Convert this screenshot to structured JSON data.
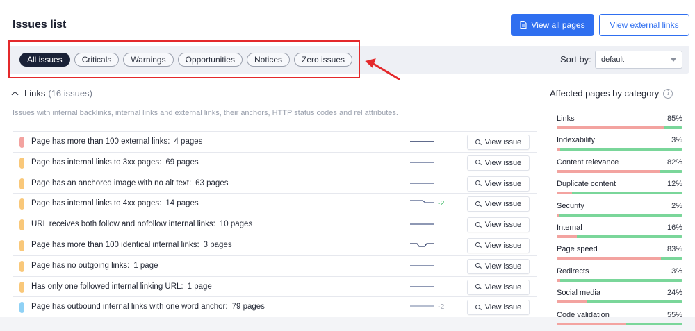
{
  "header": {
    "title": "Issues list",
    "view_all_pages": "View all pages",
    "view_external_links": "View external links"
  },
  "filters": [
    {
      "label": "All issues",
      "active": true
    },
    {
      "label": "Criticals",
      "active": false
    },
    {
      "label": "Warnings",
      "active": false
    },
    {
      "label": "Opportunities",
      "active": false
    },
    {
      "label": "Notices",
      "active": false
    },
    {
      "label": "Zero issues",
      "active": false
    }
  ],
  "sort": {
    "label": "Sort by:",
    "value": "default"
  },
  "section": {
    "name": "Links",
    "count": "(16 issues)",
    "description": "Issues with internal backlinks, internal links and external links, their anchors, HTTP status codes and rel attributes."
  },
  "issues": [
    {
      "name": "Page has more than 100 external links:",
      "count": "4 pages",
      "severity": "critical",
      "delta": "",
      "trend": "flat-dark"
    },
    {
      "name": "Page has internal links to 3xx pages:",
      "count": "69 pages",
      "severity": "warning",
      "delta": "",
      "trend": "flat"
    },
    {
      "name": "Page has an anchored image with no alt text:",
      "count": "63 pages",
      "severity": "warning",
      "delta": "",
      "trend": "flat"
    },
    {
      "name": "Page has internal links to 4xx pages:",
      "count": "14 pages",
      "severity": "warning",
      "delta": "-2",
      "trend": "drop"
    },
    {
      "name": "URL receives both follow and nofollow internal links:",
      "count": "10 pages",
      "severity": "warning",
      "delta": "",
      "trend": "flat"
    },
    {
      "name": "Page has more than 100 identical internal links:",
      "count": "3 pages",
      "severity": "warning",
      "delta": "",
      "trend": "dip"
    },
    {
      "name": "Page has no outgoing links:",
      "count": "1 page",
      "severity": "warning",
      "delta": "",
      "trend": "flat"
    },
    {
      "name": "Has only one followed internal linking URL:",
      "count": "1 page",
      "severity": "warning",
      "delta": "",
      "trend": "flat"
    },
    {
      "name": "Page has outbound internal links with one word anchor:",
      "count": "79 pages",
      "severity": "notice",
      "delta": "-2",
      "trend": "flat-light"
    }
  ],
  "view_issue_label": "View issue",
  "colors": {
    "critical": "#f3a3a0",
    "warning": "#f9c87a",
    "notice": "#8fd1f5",
    "delta_green": "#2fb35a",
    "delta_grey": "#9aa0ad",
    "accent": "#2f6ff0"
  },
  "affected": {
    "title": "Affected pages by category",
    "categories": [
      {
        "name": "Links",
        "pct": "85%",
        "value": 0.85
      },
      {
        "name": "Indexability",
        "pct": "3%",
        "value": 0.03
      },
      {
        "name": "Content relevance",
        "pct": "82%",
        "value": 0.82
      },
      {
        "name": "Duplicate content",
        "pct": "12%",
        "value": 0.12
      },
      {
        "name": "Security",
        "pct": "2%",
        "value": 0.02
      },
      {
        "name": "Internal",
        "pct": "16%",
        "value": 0.16
      },
      {
        "name": "Page speed",
        "pct": "83%",
        "value": 0.83
      },
      {
        "name": "Redirects",
        "pct": "3%",
        "value": 0.03
      },
      {
        "name": "Social media",
        "pct": "24%",
        "value": 0.24
      },
      {
        "name": "Code validation",
        "pct": "55%",
        "value": 0.55
      }
    ]
  }
}
